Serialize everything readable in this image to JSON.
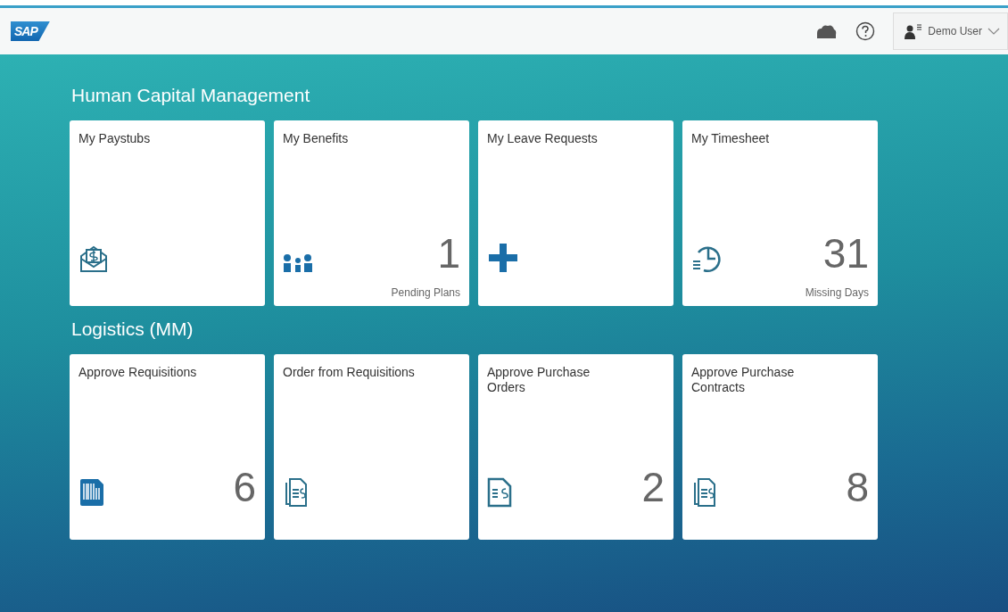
{
  "header": {
    "logo": "SAP",
    "user": "Demo User"
  },
  "groups": [
    {
      "title": "Human Capital Management",
      "tiles": [
        {
          "title": "My Paystubs"
        },
        {
          "title": "My Benefits",
          "number": "1",
          "footer": "Pending Plans"
        },
        {
          "title": "My Leave Requests"
        },
        {
          "title": "My Timesheet",
          "number": "31",
          "footer": "Missing Days"
        }
      ]
    },
    {
      "title": "Logistics (MM)",
      "tiles": [
        {
          "title": "Approve Requisitions",
          "number": "6"
        },
        {
          "title": "Order from Requisitions"
        },
        {
          "title": "Approve Purchase Orders",
          "number": "2"
        },
        {
          "title": "Approve Purchase Contracts",
          "number": "8"
        }
      ]
    }
  ]
}
